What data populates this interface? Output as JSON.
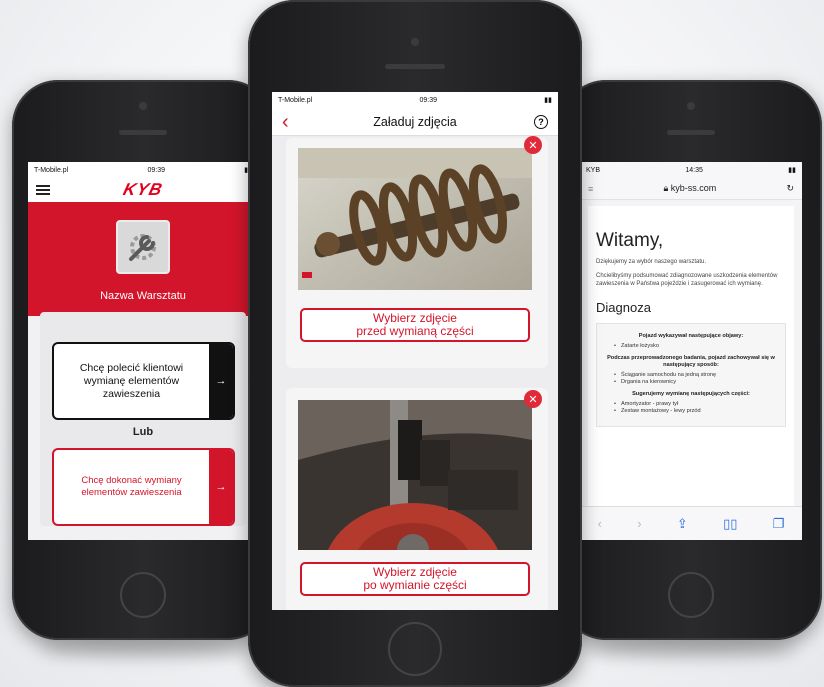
{
  "left_phone": {
    "status": {
      "carrier": "T-Mobile.pl",
      "time": "09:39",
      "battery": ""
    },
    "logo": "KYB",
    "workshop_name": "Nazwa Warsztatu",
    "option_recommend": "Chcę polecić klientowi wymianę elementów zawieszenia",
    "separator": "Lub",
    "option_replace": "Chcę dokonać wymiany elementów zawieszenia",
    "arrow": "→",
    "icons": {
      "menu": "hamburger-icon",
      "workshop": "wrench-gear-icon"
    }
  },
  "center_phone": {
    "status": {
      "carrier": "T-Mobile.pl",
      "time": "09:39"
    },
    "title": "Załaduj zdjęcia",
    "back": "‹",
    "help": "?",
    "before": {
      "button_line1": "Wybierz zdjęcie",
      "button_line2": "przed wymianą części",
      "close": "✕"
    },
    "after": {
      "button_line1": "Wybierz zdjęcie",
      "button_line2": "po wymianie części",
      "close": "✕"
    }
  },
  "right_phone": {
    "status": {
      "carrier": "KYB",
      "time": "14:35"
    },
    "url": "kyb-ss.com",
    "heading": "Witamy,",
    "intro1": "Dziękujemy za wybór naszego warsztatu.",
    "intro2": "Chcielibyśmy podsumować zdiagnozowane uszkodzenia elementów zawieszenia w Państwa pojeździe i zasugerować ich wymianę.",
    "diag_title": "Diagnoza",
    "symptoms_title": "Pojazd wykazywał następujące objawy:",
    "symptoms": [
      "Zatarte łożysko"
    ],
    "behavior_title": "Podczas przeprowadzonego badania, pojazd zachowywał się w następujący sposób:",
    "behaviors": [
      "Ściąganie samochodu na jedną stronę",
      "Drgania na kierownicy"
    ],
    "replace_title": "Sugerujemy wymianę następujących części:",
    "parts": [
      "Amortyzator - prawy tył",
      "Zestaw montażowy - lewy przód"
    ],
    "toolbar": {
      "back": "‹",
      "forward": "›",
      "share": "⇪",
      "bookmarks": "▯▯",
      "tabs": "❐"
    }
  },
  "colors": {
    "kyb_red": "#d3152b",
    "badge_red": "#e02a3a",
    "safari_blue": "#2a6de0"
  }
}
